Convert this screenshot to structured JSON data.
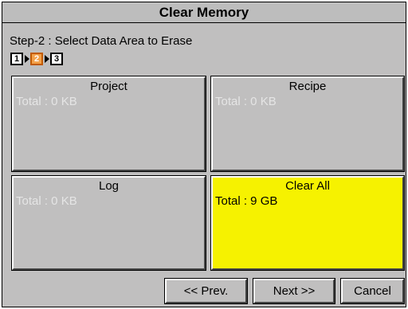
{
  "title": "Clear Memory",
  "step_label": "Step-2 : Select Data Area to Erase",
  "steps": [
    {
      "label": "1",
      "active": false
    },
    {
      "label": "2",
      "active": true
    },
    {
      "label": "3",
      "active": false
    }
  ],
  "tiles": [
    {
      "name": "Project",
      "total": "Total : 0 KB",
      "selected": false
    },
    {
      "name": "Recipe",
      "total": "Total : 0 KB",
      "selected": false
    },
    {
      "name": "Log",
      "total": "Total : 0 KB",
      "selected": false
    },
    {
      "name": "Clear All",
      "total": "Total : 9 GB",
      "selected": true
    }
  ],
  "buttons": {
    "prev": "<< Prev.",
    "next": "Next >>",
    "cancel": "Cancel"
  },
  "colors": {
    "panel_bg": "#c0bfbf",
    "selected_tile": "#f6f200",
    "active_step": "#f4a14a",
    "disabled_text": "#e5e5e5"
  }
}
